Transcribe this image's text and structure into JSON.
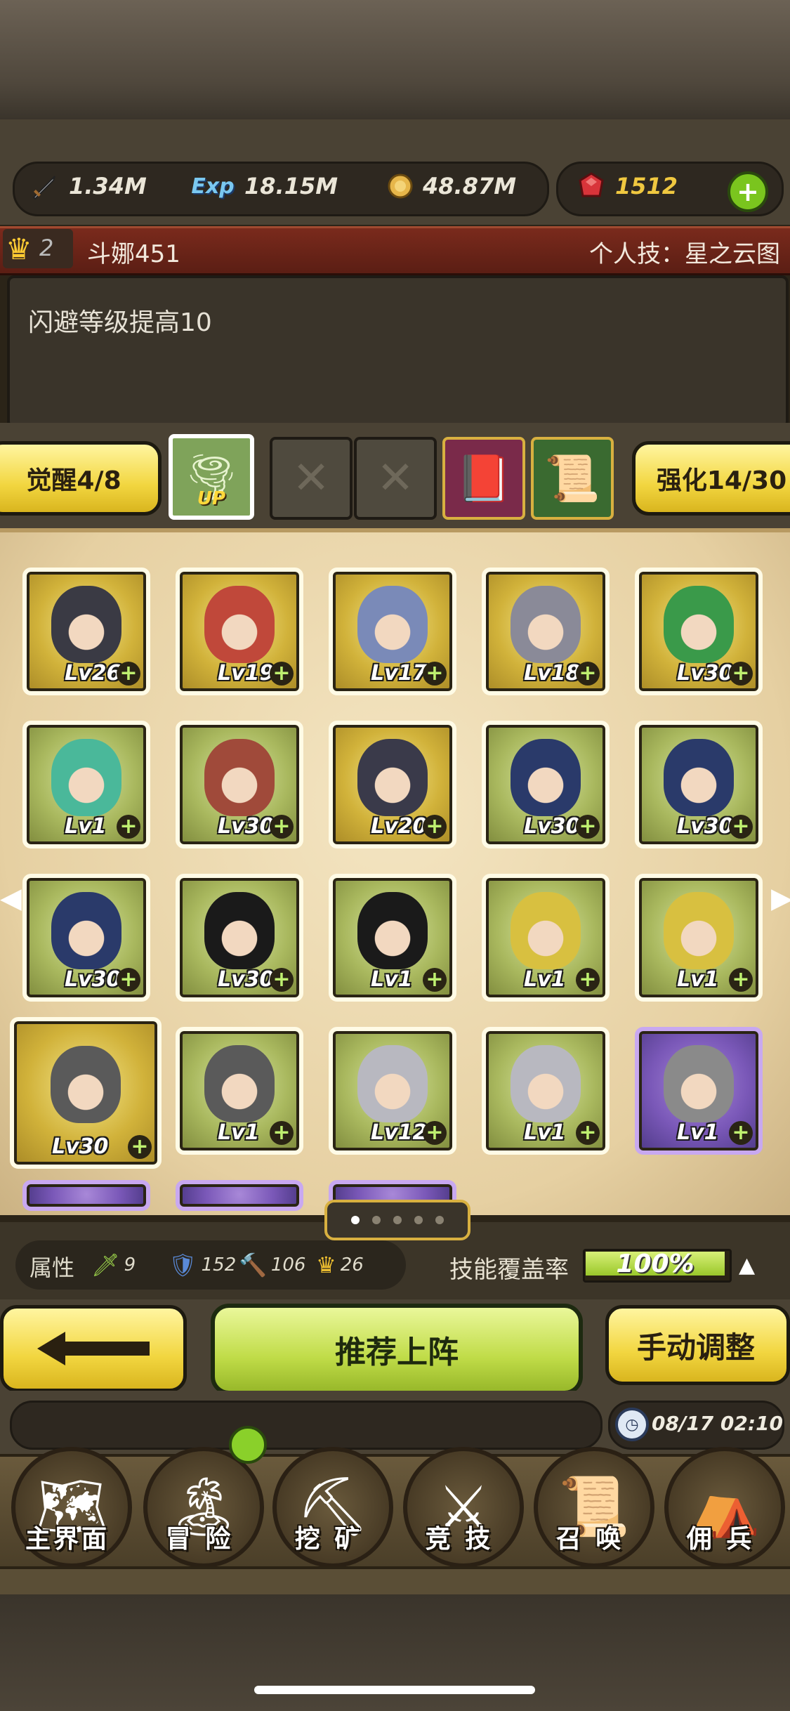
{
  "resources": {
    "attack": "1.34M",
    "exp_label": "Exp",
    "exp": "18.15M",
    "gold": "48.87M",
    "gems": "1512",
    "add": "+"
  },
  "character": {
    "rank": "2",
    "name": "斗娜451",
    "skill": "个人技：星之云图",
    "description": "闪避等级提高10"
  },
  "upgrade": {
    "awaken": "觉醒4/8",
    "strengthen": "强化14/30",
    "up_badge": "UP"
  },
  "heroes": [
    {
      "lv": "Lv26",
      "tone": "gold"
    },
    {
      "lv": "Lv19",
      "tone": "gold"
    },
    {
      "lv": "Lv17",
      "tone": "gold"
    },
    {
      "lv": "Lv18",
      "tone": "gold"
    },
    {
      "lv": "Lv30",
      "tone": "gold"
    },
    {
      "lv": "Lv1",
      "tone": "green"
    },
    {
      "lv": "Lv30",
      "tone": "green"
    },
    {
      "lv": "Lv20",
      "tone": "gold"
    },
    {
      "lv": "Lv30",
      "tone": "green"
    },
    {
      "lv": "Lv30",
      "tone": "green"
    },
    {
      "lv": "Lv30",
      "tone": "green"
    },
    {
      "lv": "Lv30",
      "tone": "green"
    },
    {
      "lv": "Lv1",
      "tone": "green"
    },
    {
      "lv": "Lv1",
      "tone": "green"
    },
    {
      "lv": "Lv1",
      "tone": "green"
    },
    {
      "lv": "Lv30",
      "tone": "gold"
    },
    {
      "lv": "Lv1",
      "tone": "green"
    },
    {
      "lv": "Lv12",
      "tone": "green"
    },
    {
      "lv": "Lv1",
      "tone": "green"
    },
    {
      "lv": "Lv1",
      "tone": "purple"
    }
  ],
  "stats": {
    "label": "属性",
    "s1": "9",
    "s2": "152",
    "s3": "106",
    "s4": "26",
    "coverage_label": "技能覆盖率",
    "coverage": "100%",
    "coverage_fraction": 1.0
  },
  "actions": {
    "recommend": "推荐上阵",
    "manual": "手动调整"
  },
  "clock": "08/17 02:10",
  "nav": [
    "主界面",
    "冒 险",
    "挖 矿",
    "竞 技",
    "召 唤",
    "佣 兵"
  ],
  "colors": {
    "accent_green": "#c0dc48",
    "accent_yellow": "#f2d640",
    "header_red": "#7a2a1c"
  }
}
